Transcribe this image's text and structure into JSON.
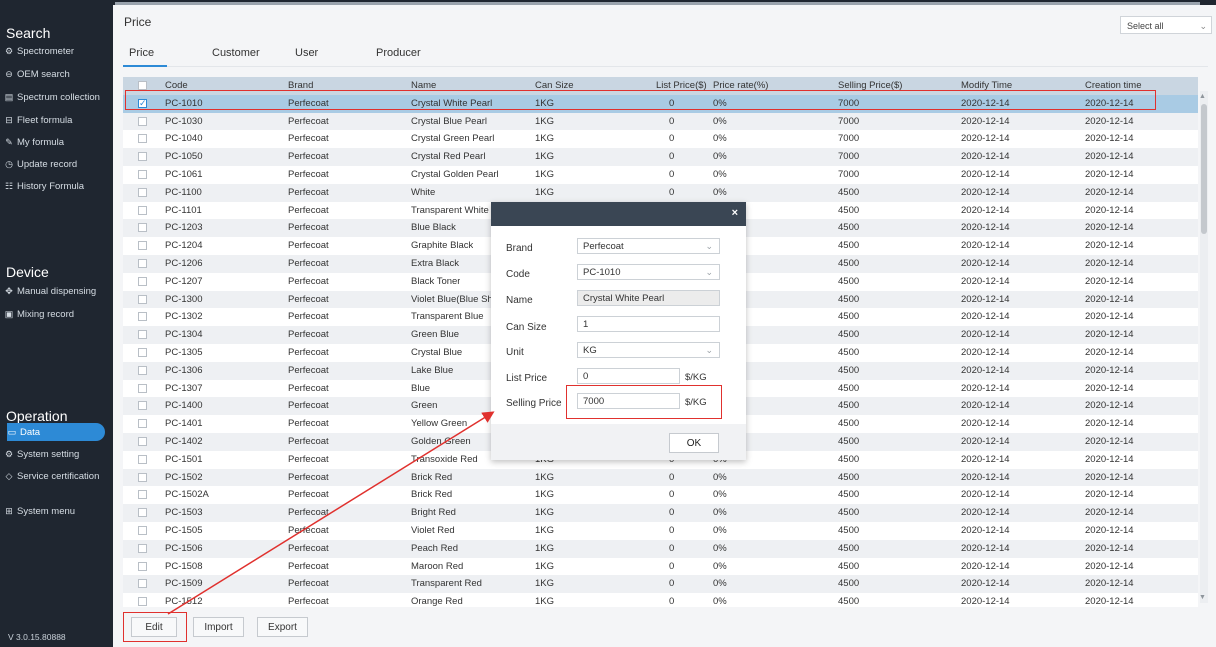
{
  "sidebar": {
    "search_title": "Search",
    "device_title": "Device",
    "operation_title": "Operation",
    "search_items": [
      {
        "label": "Spectrometer",
        "icon": "spectrometer-icon"
      },
      {
        "label": "OEM search",
        "icon": "oem-icon"
      },
      {
        "label": "Spectrum collection",
        "icon": "spectrum-icon"
      },
      {
        "label": "Fleet formula",
        "icon": "fleet-icon"
      },
      {
        "label": "My formula",
        "icon": "edit-icon"
      },
      {
        "label": "Update record",
        "icon": "clock-icon"
      },
      {
        "label": "History Formula",
        "icon": "history-icon"
      }
    ],
    "device_items": [
      {
        "label": "Manual dispensing",
        "icon": "dispense-icon"
      },
      {
        "label": "Mixing record",
        "icon": "record-icon"
      }
    ],
    "operation_items": [
      {
        "label": "Data",
        "icon": "data-icon",
        "active": true
      },
      {
        "label": "System setting",
        "icon": "gear-icon"
      },
      {
        "label": "Service certification",
        "icon": "shield-icon"
      },
      {
        "label": "System menu",
        "icon": "grid-icon"
      }
    ],
    "version": "V 3.0.15.80888",
    "colors": {
      "background": "#1f2630",
      "active": "#2d8ad6"
    }
  },
  "header": {
    "title": "Price",
    "select_all": "Select all",
    "tabs": [
      "Price",
      "Customer",
      "User",
      "Producer"
    ]
  },
  "table": {
    "columns": [
      "Code",
      "Brand",
      "Name",
      "Can Size",
      "List Price($)",
      "Price rate(%)",
      "Selling Price($)",
      "Modify Time",
      "Creation time"
    ],
    "rows": [
      [
        "PC-1010",
        "Perfecoat",
        "Crystal White Pearl",
        "1KG",
        "0",
        "0%",
        "7000",
        "2020-12-14",
        "2020-12-14"
      ],
      [
        "PC-1030",
        "Perfecoat",
        "Crystal Blue Pearl",
        "1KG",
        "0",
        "0%",
        "7000",
        "2020-12-14",
        "2020-12-14"
      ],
      [
        "PC-1040",
        "Perfecoat",
        "Crystal Green Pearl",
        "1KG",
        "0",
        "0%",
        "7000",
        "2020-12-14",
        "2020-12-14"
      ],
      [
        "PC-1050",
        "Perfecoat",
        "Crystal Red Pearl",
        "1KG",
        "0",
        "0%",
        "7000",
        "2020-12-14",
        "2020-12-14"
      ],
      [
        "PC-1061",
        "Perfecoat",
        "Crystal Golden Pearl",
        "1KG",
        "0",
        "0%",
        "7000",
        "2020-12-14",
        "2020-12-14"
      ],
      [
        "PC-1100",
        "Perfecoat",
        "White",
        "1KG",
        "0",
        "0%",
        "4500",
        "2020-12-14",
        "2020-12-14"
      ],
      [
        "PC-1101",
        "Perfecoat",
        "Transparent White",
        "",
        "",
        "",
        "4500",
        "2020-12-14",
        "2020-12-14"
      ],
      [
        "PC-1203",
        "Perfecoat",
        "Blue Black",
        "",
        "",
        "",
        "4500",
        "2020-12-14",
        "2020-12-14"
      ],
      [
        "PC-1204",
        "Perfecoat",
        "Graphite Black",
        "",
        "",
        "",
        "4500",
        "2020-12-14",
        "2020-12-14"
      ],
      [
        "PC-1206",
        "Perfecoat",
        "Extra Black",
        "",
        "",
        "",
        "4500",
        "2020-12-14",
        "2020-12-14"
      ],
      [
        "PC-1207",
        "Perfecoat",
        "Black Toner",
        "",
        "",
        "",
        "4500",
        "2020-12-14",
        "2020-12-14"
      ],
      [
        "PC-1300",
        "Perfecoat",
        "Violet Blue(Blue Sh",
        "",
        "",
        "",
        "4500",
        "2020-12-14",
        "2020-12-14"
      ],
      [
        "PC-1302",
        "Perfecoat",
        "Transparent Blue",
        "",
        "",
        "",
        "4500",
        "2020-12-14",
        "2020-12-14"
      ],
      [
        "PC-1304",
        "Perfecoat",
        "Green Blue",
        "",
        "",
        "",
        "4500",
        "2020-12-14",
        "2020-12-14"
      ],
      [
        "PC-1305",
        "Perfecoat",
        "Crystal Blue",
        "",
        "",
        "",
        "4500",
        "2020-12-14",
        "2020-12-14"
      ],
      [
        "PC-1306",
        "Perfecoat",
        "Lake Blue",
        "",
        "",
        "",
        "4500",
        "2020-12-14",
        "2020-12-14"
      ],
      [
        "PC-1307",
        "Perfecoat",
        "Blue",
        "",
        "",
        "",
        "4500",
        "2020-12-14",
        "2020-12-14"
      ],
      [
        "PC-1400",
        "Perfecoat",
        "Green",
        "",
        "",
        "",
        "4500",
        "2020-12-14",
        "2020-12-14"
      ],
      [
        "PC-1401",
        "Perfecoat",
        "Yellow Green",
        "",
        "",
        "",
        "4500",
        "2020-12-14",
        "2020-12-14"
      ],
      [
        "PC-1402",
        "Perfecoat",
        "Golden Green",
        "",
        "",
        "",
        "4500",
        "2020-12-14",
        "2020-12-14"
      ],
      [
        "PC-1501",
        "Perfecoat",
        "Transoxide Red",
        "1KG",
        "0",
        "0%",
        "4500",
        "2020-12-14",
        "2020-12-14"
      ],
      [
        "PC-1502",
        "Perfecoat",
        "Brick Red",
        "1KG",
        "0",
        "0%",
        "4500",
        "2020-12-14",
        "2020-12-14"
      ],
      [
        "PC-1502A",
        "Perfecoat",
        "Brick Red",
        "1KG",
        "0",
        "0%",
        "4500",
        "2020-12-14",
        "2020-12-14"
      ],
      [
        "PC-1503",
        "Perfecoat",
        "Bright Red",
        "1KG",
        "0",
        "0%",
        "4500",
        "2020-12-14",
        "2020-12-14"
      ],
      [
        "PC-1505",
        "Perfecoat",
        "Violet Red",
        "1KG",
        "0",
        "0%",
        "4500",
        "2020-12-14",
        "2020-12-14"
      ],
      [
        "PC-1506",
        "Perfecoat",
        "Peach Red",
        "1KG",
        "0",
        "0%",
        "4500",
        "2020-12-14",
        "2020-12-14"
      ],
      [
        "PC-1508",
        "Perfecoat",
        "Maroon Red",
        "1KG",
        "0",
        "0%",
        "4500",
        "2020-12-14",
        "2020-12-14"
      ],
      [
        "PC-1509",
        "Perfecoat",
        "Transparent Red",
        "1KG",
        "0",
        "0%",
        "4500",
        "2020-12-14",
        "2020-12-14"
      ],
      [
        "PC-1512",
        "Perfecoat",
        "Orange Red",
        "1KG",
        "0",
        "0%",
        "4500",
        "2020-12-14",
        "2020-12-14"
      ]
    ],
    "selected_row": 0,
    "colors": {
      "header": "#c9d6e2",
      "selected": "#a9cbe4",
      "stripe": "#eef0f3"
    }
  },
  "buttons": {
    "edit": "Edit",
    "import": "Import",
    "export": "Export"
  },
  "dialog": {
    "close": "×",
    "brand_label": "Brand",
    "brand_value": "Perfecoat",
    "code_label": "Code",
    "code_value": "PC-1010",
    "name_label": "Name",
    "name_value": "Crystal White Pearl",
    "can_size_label": "Can Size",
    "can_size_value": "1",
    "unit_label": "Unit",
    "unit_value": "KG",
    "list_price_label": "List Price",
    "list_price_value": "0",
    "list_price_unit": "$/KG",
    "selling_price_label": "Selling Price",
    "selling_price_value": "7000",
    "selling_price_unit": "$/KG",
    "ok": "OK"
  },
  "annotation_color": "#e0312e"
}
